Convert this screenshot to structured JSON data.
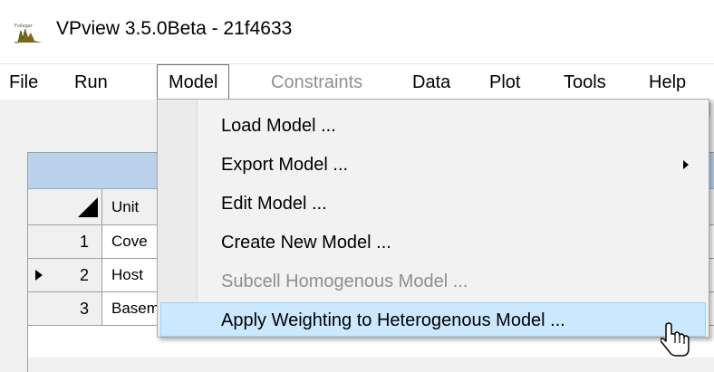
{
  "window": {
    "title": "VPview 3.5.0Beta - 21f4633"
  },
  "menubar": {
    "items": [
      {
        "label": "File",
        "state": "normal"
      },
      {
        "label": "Run",
        "state": "normal"
      },
      {
        "label": "Model",
        "state": "open"
      },
      {
        "label": "Constraints",
        "state": "disabled"
      },
      {
        "label": "Data",
        "state": "normal"
      },
      {
        "label": "Plot",
        "state": "normal"
      },
      {
        "label": "Tools",
        "state": "normal"
      },
      {
        "label": "Help",
        "state": "normal"
      }
    ]
  },
  "model_menu": {
    "items": [
      {
        "label": "Load Model ...",
        "state": "normal"
      },
      {
        "label": "Export Model ...",
        "state": "normal",
        "has_submenu": true
      },
      {
        "label": "Edit Model ...",
        "state": "normal"
      },
      {
        "label": "Create New Model ...",
        "state": "normal"
      },
      {
        "label": "Subcell Homogenous Model ...",
        "state": "disabled"
      },
      {
        "label": "Apply Weighting to Heterogenous Model ...",
        "state": "highlighted"
      }
    ]
  },
  "grid": {
    "column_header": "Unit",
    "rows": [
      {
        "num": "1",
        "unit": "Cove",
        "current": false
      },
      {
        "num": "2",
        "unit": "Host",
        "current": true
      },
      {
        "num": "3",
        "unit": "Basem",
        "current": false
      }
    ]
  },
  "colors": {
    "menu_highlight": "#cce8ff",
    "menu_highlight_border": "#99d1ff",
    "grid_caption": "#b9d1ea",
    "disabled_text": "#8f8f8f"
  },
  "icons": {
    "app": "app-logo-icon",
    "submenu": "chevron-right-icon",
    "cursor": "mouse-pointer-icon"
  }
}
